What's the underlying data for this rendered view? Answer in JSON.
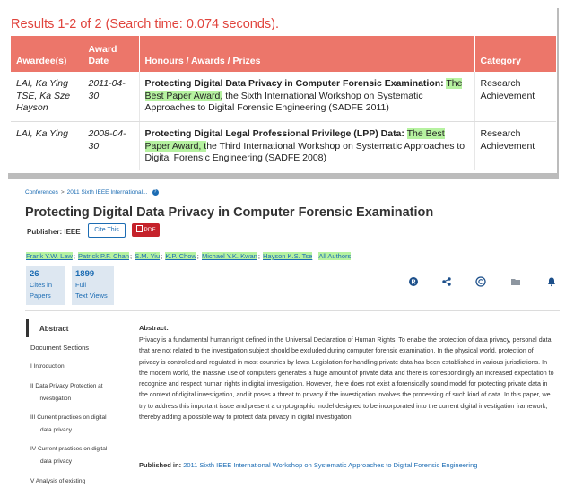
{
  "results": {
    "title": "Results 1-2 of 2 (Search time: 0.074 seconds).",
    "columns": [
      "Awardee(s)",
      "Award Date",
      "Honours / Awards / Prizes",
      "Category"
    ],
    "rows": [
      {
        "awardee_1": "LAI, Ka Ying",
        "awardee_2": "TSE, Ka Sze",
        "awardee_3": "Hayson",
        "date": "2011-04-30",
        "honour_title": "Protecting Digital Data Privacy in Computer Forensic Examination:",
        "honour_award": "The Best Paper Award,",
        "honour_rest": " the Sixth International Workshop on Systematic Approaches to Digital Forensic Engineering (SADFE 2011)",
        "category": "Research Achievement"
      },
      {
        "awardee_1": "LAI, Ka Ying",
        "date": "2008-04-30",
        "honour_title": "Protecting Digital Legal Professional Privilege (LPP) Data:",
        "honour_award": "The Best Paper Award, t",
        "honour_rest": "he Third International Workshop on Systematic Approaches to Digital Forensic Engineering (SADFE 2008)",
        "category": "Research Achievement"
      }
    ]
  },
  "ieee": {
    "breadcrumb": [
      "Conferences",
      "2011 Sixth IEEE International..."
    ],
    "breadcrumb_sep": ">",
    "help_glyph": "?",
    "title": "Protecting Digital Data Privacy in Computer Forensic Examination",
    "publisher_label": "Publisher:",
    "publisher_value": "IEEE",
    "cite_button": "Cite This",
    "pdf_button": "PDF",
    "authors": [
      "Frank Y.W. Law",
      "Patrick P.F. Chan",
      "S.M. Yiu",
      "K.P. Chow",
      "Michael Y.K. Kwan",
      "Hayson K.S. Tse"
    ],
    "author_sep": ";",
    "all_authors": "All Authors",
    "metrics": [
      {
        "value": "26",
        "line1": "Cites in",
        "line2": "Papers"
      },
      {
        "value": "1899",
        "line1": "Full",
        "line2": "Text Views"
      }
    ],
    "tools": [
      "rights-icon",
      "share-icon",
      "copyright-icon",
      "folder-icon",
      "alert-bell-icon"
    ],
    "sections": {
      "abstract_tab": "Abstract",
      "heading": "Document Sections",
      "items": [
        {
          "l1": "I  Introduction"
        },
        {
          "l1": "II  Data Privacy Protection at",
          "l2": "investigation"
        },
        {
          "l1": "III  Current practices on digital",
          "l2": "data privacy"
        },
        {
          "l1": "IV  Current practices on digital",
          "l2": "data privacy"
        },
        {
          "l1": "V  Analysis of existing"
        }
      ]
    },
    "abstract_heading": "Abstract:",
    "abstract_text": "Privacy is a fundamental human right defined in the Universal Declaration of Human Rights. To enable the protection of data privacy, personal data that are not related to the investigation subject should be excluded during computer forensic examination. In the physical world, protection of privacy is controlled and regulated in most countries by laws. Legislation for handling private data has been established in various jurisdictions. In the modern world, the massive use of computers generates a huge amount of private data and there is correspondingly an increased expectation to recognize and respect human rights in digital investigation. However, there does not exist a forensically sound model for protecting private data in the context of digital investigation, and it poses a threat to privacy if the investigation involves the processing of such kind of data. In this paper, we try to address this important issue and present a cryptographic model designed to be incorporated into the current digital investigation framework, thereby adding a possible way to protect data privacy in digital investigation.",
    "published_label": "Published in:",
    "published_value": "2011 Sixth IEEE International Workshop on Systematic Approaches to Digital Forensic Engineering"
  },
  "colors": {
    "header_red": "#ec766a",
    "title_red": "#e0433c",
    "highlight_green": "#b6f2a0",
    "ieee_blue": "#1c6cb3",
    "pdf_red": "#c5222b"
  }
}
